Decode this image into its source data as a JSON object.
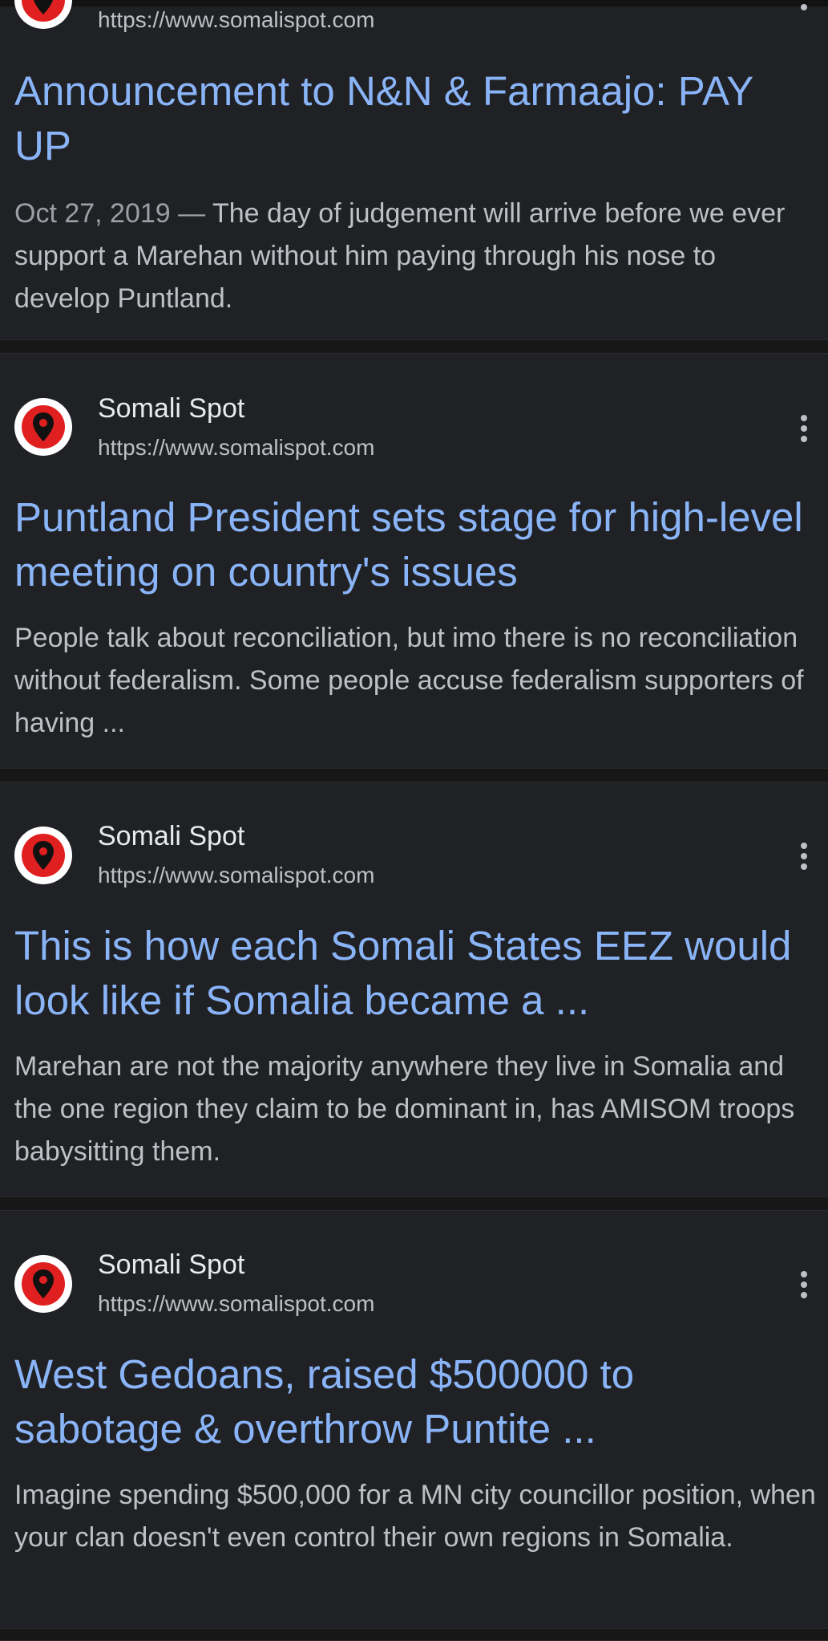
{
  "results": [
    {
      "site_name": "",
      "url": "https://www.somalispot.com",
      "title": "Announcement to N&N & Farmaajo: PAY UP",
      "date": "Oct 27, 2019 — ",
      "snippet": "The day of judgement will arrive before we ever support a Marehan without him paying through his nose to develop Puntland."
    },
    {
      "site_name": "Somali Spot",
      "url": "https://www.somalispot.com",
      "title": "Puntland President sets stage for high-level meeting on country's issues",
      "snippet": "People talk about reconciliation, but imo there is no reconciliation without federalism. Some people accuse federalism supporters of having ..."
    },
    {
      "site_name": "Somali Spot",
      "url": "https://www.somalispot.com",
      "title": "This is how each Somali States EEZ would look like if Somalia became a ...",
      "snippet": "Marehan are not the majority anywhere they live in Somalia and the one region they claim to be dominant in, has AMISOM troops babysitting them."
    },
    {
      "site_name": "Somali Spot",
      "url": "https://www.somalispot.com",
      "title": "West Gedoans, raised $500000 to sabotage & overthrow Puntite ...",
      "snippet": "Imagine spending $500,000 for a MN city councillor position, when your clan doesn't even control their own regions in Somalia."
    }
  ],
  "colors": {
    "background": "#171717",
    "card": "#202124",
    "title_link": "#8ab4f8",
    "snippet_text": "#bdc1c6",
    "favicon_red": "#e02020"
  },
  "icons": {
    "favicon": "somalispot-map-pin-icon",
    "more": "more-vert-icon"
  }
}
